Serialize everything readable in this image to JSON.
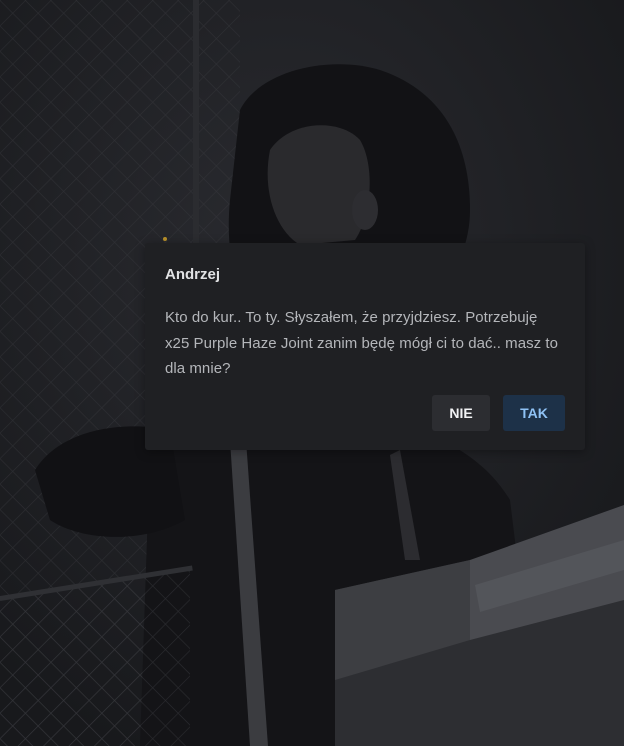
{
  "dialog": {
    "title": "Andrzej",
    "message": "Kto do kur.. To ty. Słyszałem, że przyjdziesz. Potrzebuję x25 Purple Haze Joint zanim będę mógł ci to dać.. masz to dla mnie?",
    "buttons": {
      "no_label": "NIE",
      "yes_label": "TAK"
    }
  },
  "colors": {
    "dialog_background": "#1f2023",
    "title_text": "#e1e2e4",
    "message_text": "#b4b6ba",
    "no_button_background": "#2c2d31",
    "yes_button_background": "#1d3148",
    "yes_button_text": "#8fc2f5"
  }
}
